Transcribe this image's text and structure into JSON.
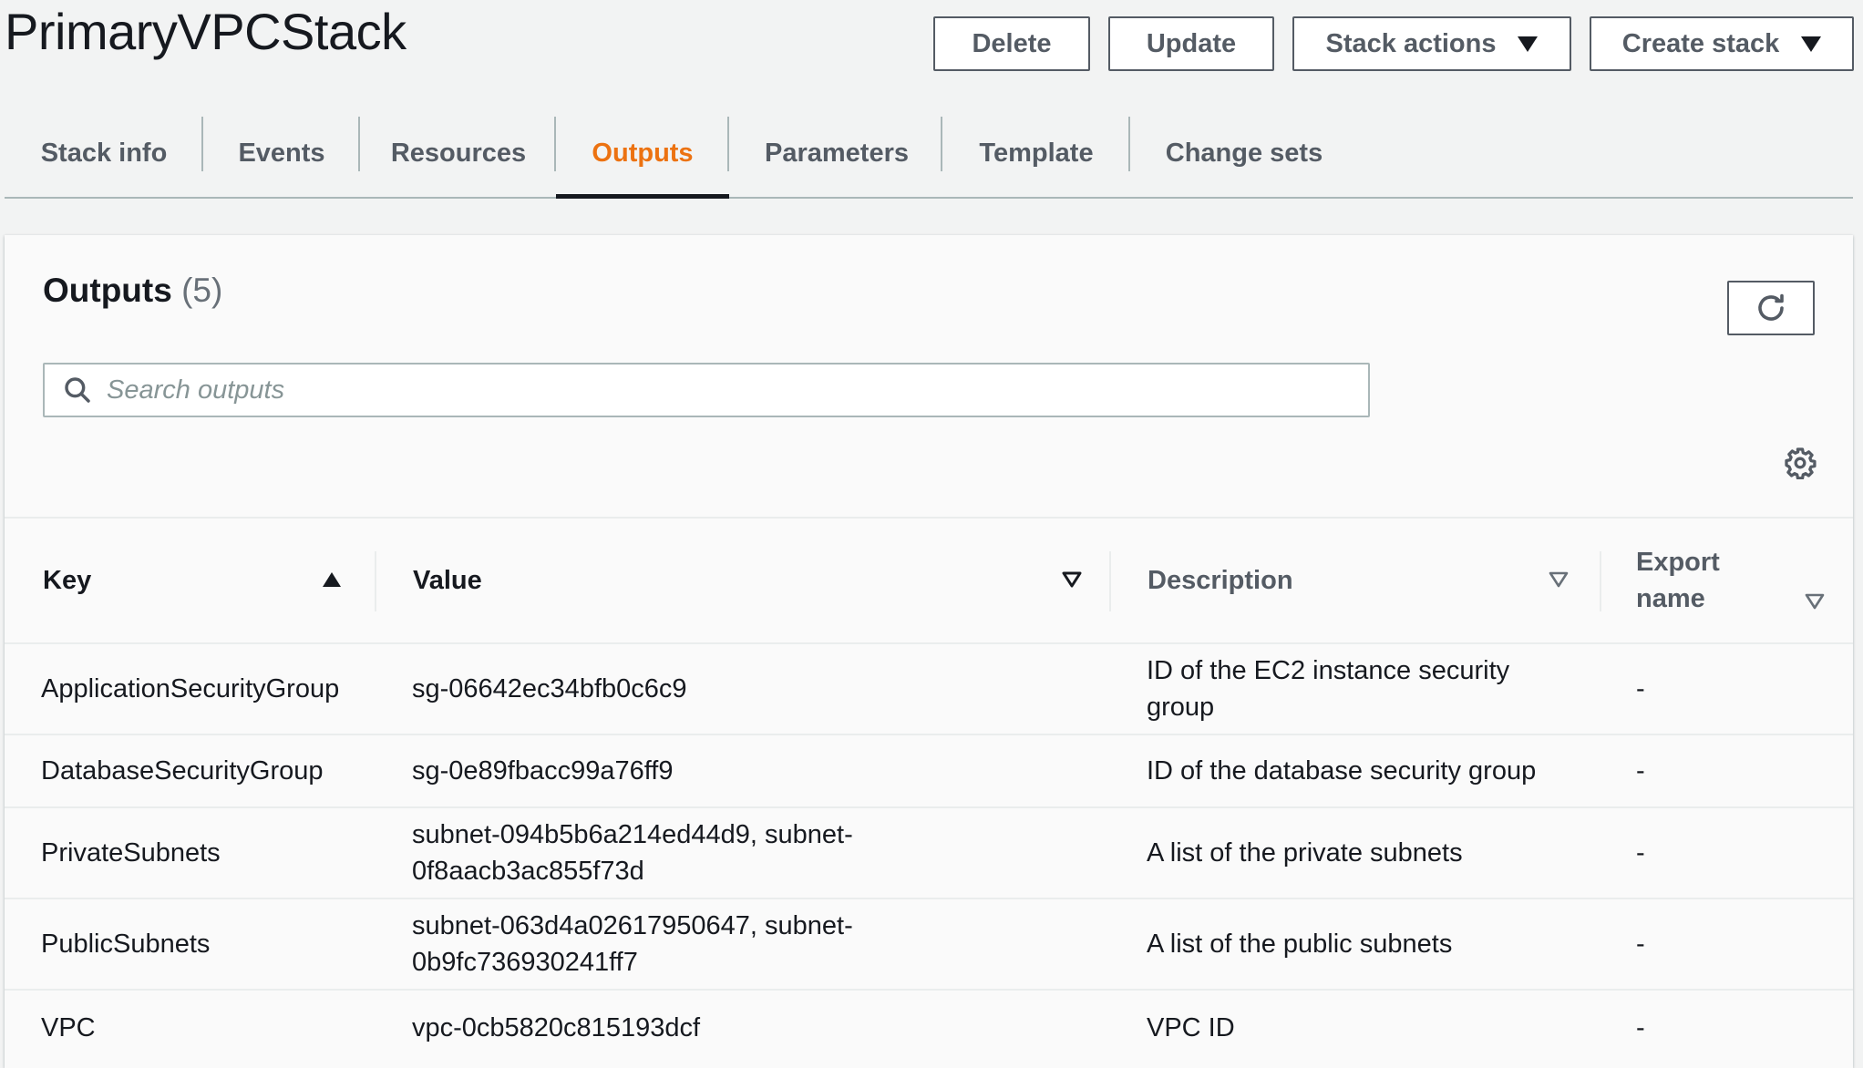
{
  "page": {
    "title": "PrimaryVPCStack"
  },
  "header_actions": {
    "delete": "Delete",
    "update": "Update",
    "stack_actions": "Stack actions",
    "create_stack": "Create stack"
  },
  "tabs": [
    {
      "label": "Stack info"
    },
    {
      "label": "Events"
    },
    {
      "label": "Resources"
    },
    {
      "label": "Outputs",
      "active": true
    },
    {
      "label": "Parameters"
    },
    {
      "label": "Template"
    },
    {
      "label": "Change sets"
    }
  ],
  "outputs": {
    "title": "Outputs",
    "count": "(5)",
    "search": {
      "placeholder": "Search outputs",
      "value": ""
    },
    "columns": {
      "key": "Key",
      "value": "Value",
      "description": "Description",
      "export_name_line1": "Export",
      "export_name_line2": "name"
    },
    "rows": [
      {
        "key": "ApplicationSecurityGroup",
        "value_line1": "sg-06642ec34bfb0c6c9",
        "value_line2": "",
        "description_line1": "ID of the EC2 instance security",
        "description_line2": "group",
        "export_name": "-"
      },
      {
        "key": "DatabaseSecurityGroup",
        "value_line1": "sg-0e89fbacc99a76ff9",
        "value_line2": "",
        "description_line1": "ID of the database security group",
        "description_line2": "",
        "export_name": "-"
      },
      {
        "key": "PrivateSubnets",
        "value_line1": "subnet-094b5b6a214ed44d9, subnet-",
        "value_line2": "0f8aacb3ac855f73d",
        "description_line1": "A list of the private subnets",
        "description_line2": "",
        "export_name": "-"
      },
      {
        "key": "PublicSubnets",
        "value_line1": "subnet-063d4a02617950647, subnet-",
        "value_line2": "0b9fc736930241ff7",
        "description_line1": "A list of the public subnets",
        "description_line2": "",
        "export_name": "-"
      },
      {
        "key": "VPC",
        "value_line1": "vpc-0cb5820c815193dcf",
        "value_line2": "",
        "description_line1": "VPC ID",
        "description_line2": "",
        "export_name": "-"
      }
    ]
  },
  "icons": {
    "dropdown": "caret-down-icon",
    "search": "search-icon",
    "refresh": "refresh-icon",
    "settings": "gear-icon",
    "sort_ascending": "sort-ascending-icon",
    "sort_available": "sort-descending-icon"
  },
  "colors": {
    "active_tab": "#ec7211",
    "text": "#16191f",
    "muted_text": "#545b64",
    "background": "#f2f3f3"
  }
}
